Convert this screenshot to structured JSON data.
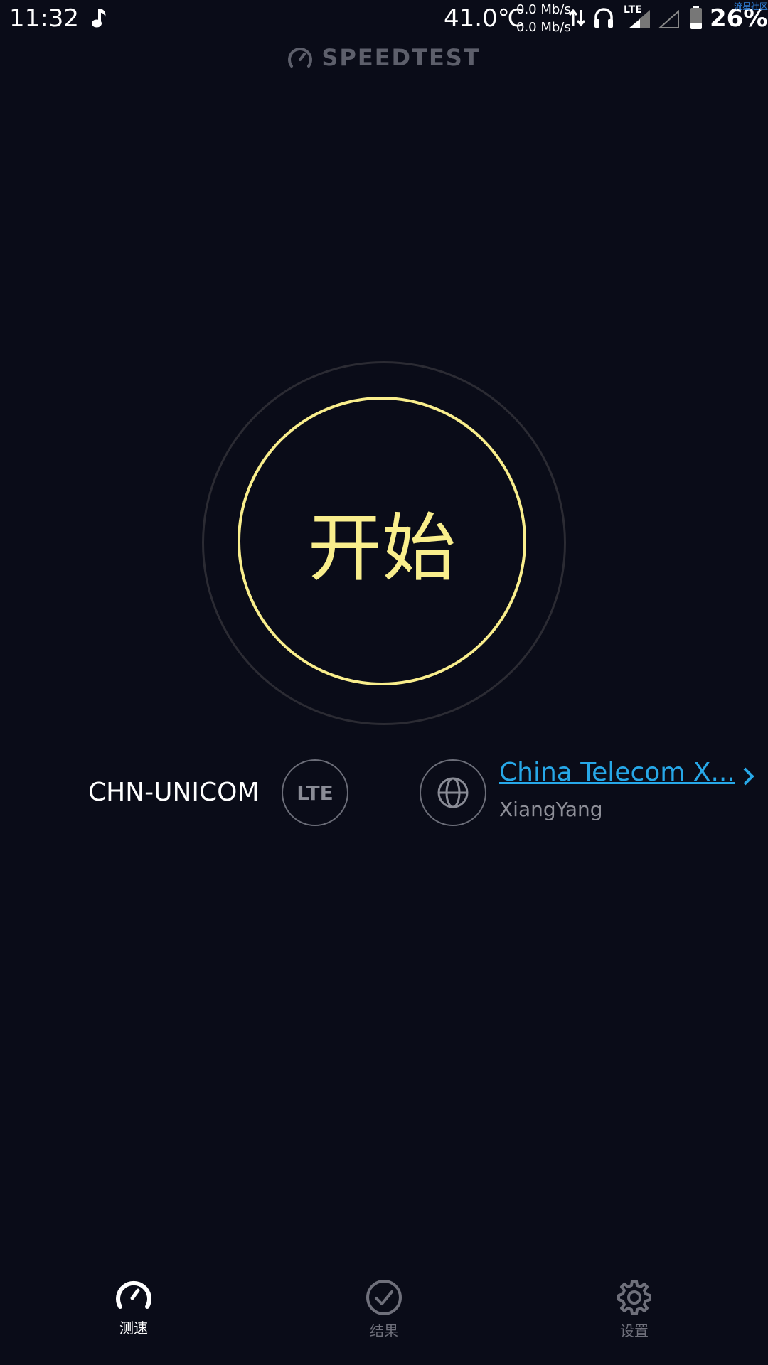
{
  "status_bar": {
    "time": "11:32",
    "temperature": "41.0℃",
    "upload_rate": "0.0 Mb/s",
    "download_rate": "0.0 Mb/s",
    "network_type": "LTE",
    "battery": "26%",
    "watermark": "流星社区"
  },
  "header": {
    "logo_text": "SPEEDTEST"
  },
  "start": {
    "label": "开始"
  },
  "connection": {
    "carrier": "CHN-UNICOM",
    "carrier_badge": "LTE",
    "server_name": "China Telecom X...",
    "server_location": "XiangYang"
  },
  "tabs": [
    {
      "label": "测速",
      "icon": "speedometer-icon",
      "active": true
    },
    {
      "label": "结果",
      "icon": "check-circle-icon",
      "active": false
    },
    {
      "label": "设置",
      "icon": "gear-icon",
      "active": false
    }
  ],
  "colors": {
    "background": "#0a0c18",
    "accent_yellow": "#f9ee8c",
    "link_blue": "#27a8e8"
  }
}
